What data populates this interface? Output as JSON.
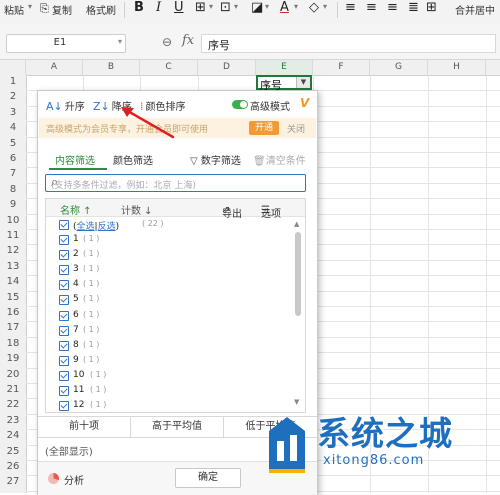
{
  "ribbon": {
    "paste": "粘贴",
    "copy": "复制",
    "format_painter": "格式刷",
    "merge": "合并居中"
  },
  "formula_bar": {
    "name_box": "E1",
    "fx": "fx",
    "content": "序号"
  },
  "grid": {
    "columns": [
      "A",
      "B",
      "C",
      "D",
      "E",
      "F",
      "G",
      "H"
    ],
    "rows": [
      "1",
      "2",
      "3",
      "4",
      "5",
      "6",
      "7",
      "8",
      "9",
      "10",
      "11",
      "12",
      "13",
      "14",
      "15",
      "16",
      "17",
      "18",
      "19",
      "20",
      "21",
      "22",
      "23",
      "24",
      "25",
      "26",
      "27"
    ],
    "active_cell_value": "序号"
  },
  "panel": {
    "sort_asc": "升序",
    "sort_desc": "降序",
    "sort_color": "颜色排序",
    "advanced_mode": "高级模式",
    "banner_text": "高级模式为会员专享，开通会员即可使用",
    "open_button": "开通",
    "close_link": "关闭",
    "tab_content": "内容筛选",
    "tab_color": "颜色筛选",
    "number_filter": "数字筛选",
    "clear_condition": "清空条件",
    "search_placeholder": "(支持多条件过滤，例如：北京 上海)",
    "list_header": {
      "name": "名称 ↑",
      "count": "计数 ↓",
      "export": "导出",
      "options": "选项"
    },
    "select_all": {
      "all": "全选",
      "invert": "反选",
      "count": "( 22 )"
    },
    "items": [
      {
        "label": "1",
        "count": "( 1 )"
      },
      {
        "label": "2",
        "count": "( 1 )"
      },
      {
        "label": "3",
        "count": "( 1 )"
      },
      {
        "label": "4",
        "count": "( 1 )"
      },
      {
        "label": "5",
        "count": "( 1 )"
      },
      {
        "label": "6",
        "count": "( 1 )"
      },
      {
        "label": "7",
        "count": "( 1 )"
      },
      {
        "label": "8",
        "count": "( 1 )"
      },
      {
        "label": "9",
        "count": "( 1 )"
      },
      {
        "label": "10",
        "count": "( 1 )"
      },
      {
        "label": "11",
        "count": "( 1 )"
      },
      {
        "label": "12",
        "count": "( 1 )"
      }
    ],
    "quick_filters": [
      "前十项",
      "高于平均值",
      "低于平均值"
    ],
    "show_all": "(全部显示)",
    "analyze": "分析",
    "ok": "确定"
  },
  "watermark": {
    "title": "系统之城",
    "domain": "xitong86.com"
  },
  "colors": {
    "accent_green": "#2f8b3e",
    "accent_blue": "#2f74c9",
    "vip_orange": "#f39b32",
    "arrow_red": "#e02020",
    "watermark_blue": "#1f6fbf"
  }
}
